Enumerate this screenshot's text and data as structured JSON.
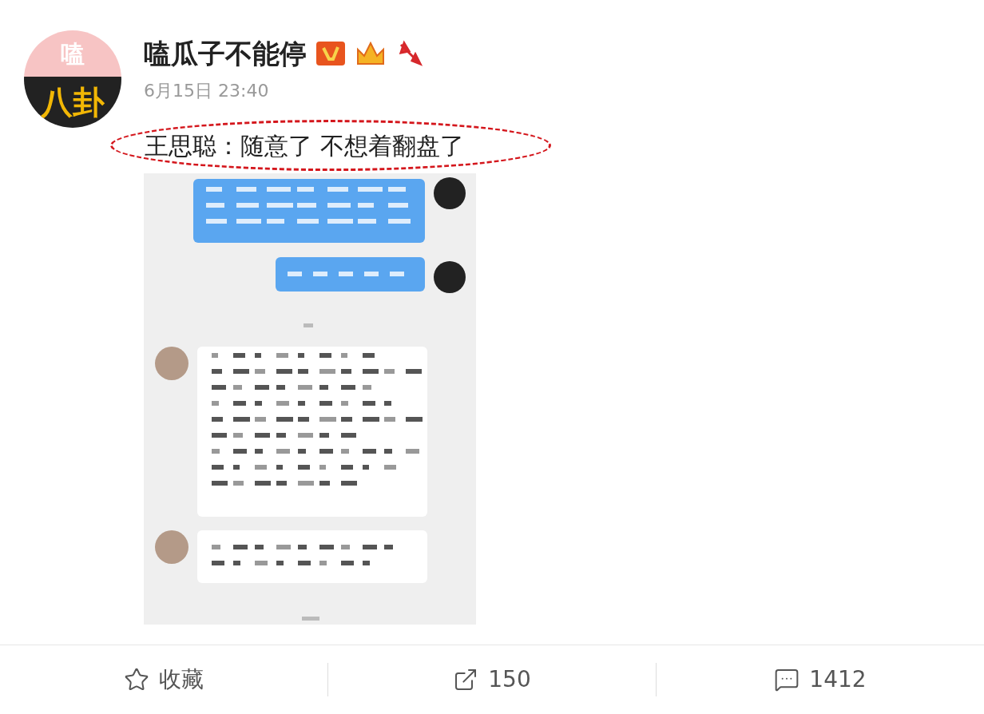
{
  "post": {
    "avatar": {
      "top_text": "嗑",
      "bottom_text": "八卦"
    },
    "author": "嗑瓜子不能停",
    "date": "6月15日 23:40",
    "text": "王思聪：随意了 不想着翻盘了"
  },
  "actions": [
    {
      "kind": "favorite",
      "label": "收藏"
    },
    {
      "kind": "share",
      "label": "150"
    },
    {
      "kind": "comment",
      "label": "1412"
    }
  ]
}
